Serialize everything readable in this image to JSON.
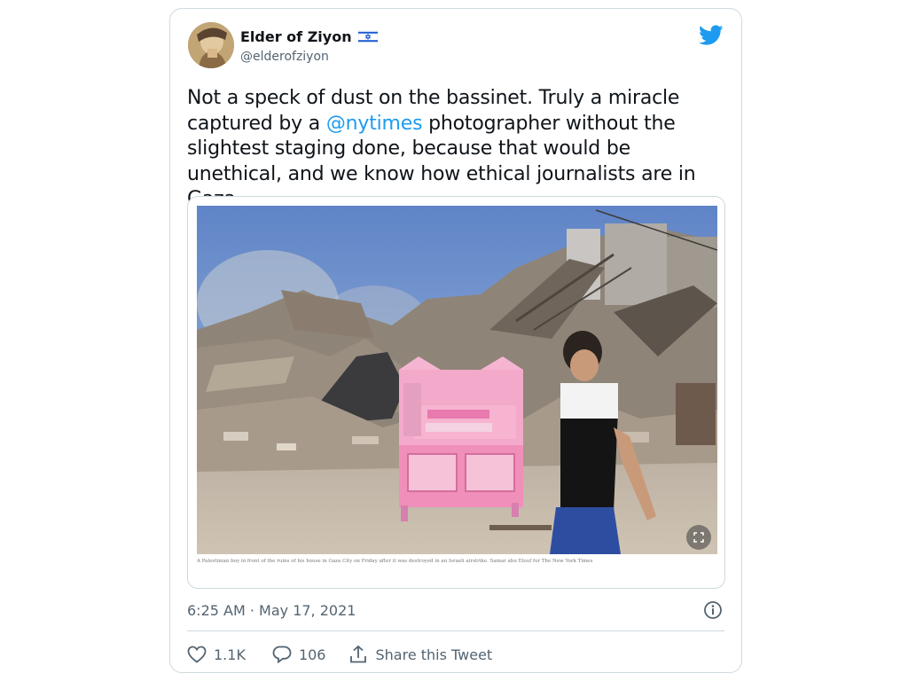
{
  "author": {
    "display_name": "Elder of Ziyon",
    "handle": "@elderofziyon",
    "flag_icon": "israel-flag-icon",
    "avatar_icon": "avatar-photo"
  },
  "tweet": {
    "text_before": "Not a speck of dust on the bassinet. Truly a miracle captured by a ",
    "mention": "@nytimes",
    "text_after": " photographer without the slightest staging done, because that would be unethical, and we know how ethical journalists are in Gaza."
  },
  "media": {
    "caption": "A Palestinian boy in front of the ruins of his house in Gaza City on Friday after it was destroyed in an Israeli airstrike.",
    "credit": "Samar abu Elouf for The New York Times"
  },
  "timestamp": "6:25 AM · May 17, 2021",
  "actions": {
    "likes": "1.1K",
    "replies": "106",
    "share_label": "Share this Tweet"
  },
  "colors": {
    "twitter_blue": "#1d9bf0",
    "text_secondary": "#536471",
    "border": "#cfd9de"
  },
  "icons": {
    "brand": "twitter-bird-icon",
    "info": "info-icon",
    "like": "heart-icon",
    "reply": "speech-bubble-icon",
    "share": "share-arrow-icon"
  }
}
